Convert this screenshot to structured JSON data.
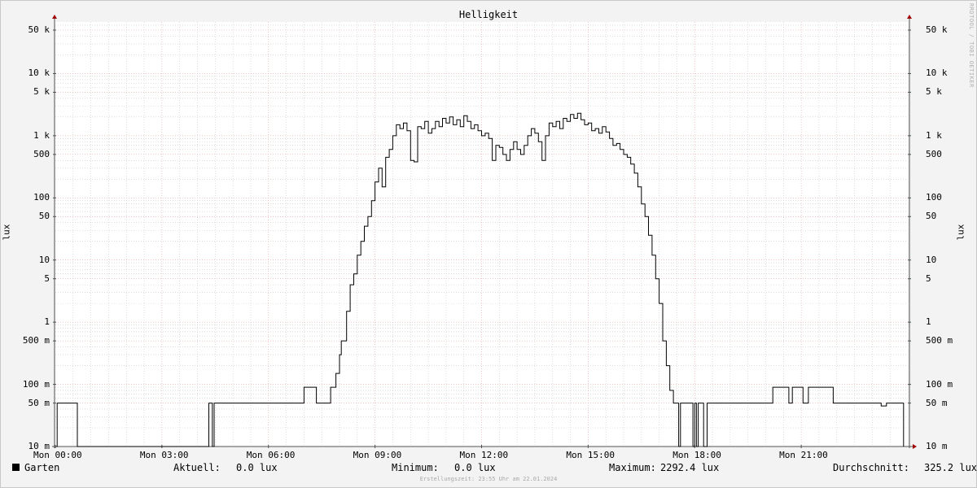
{
  "title": "Helligkeit",
  "ylabel_left": "lux",
  "ylabel_right": "lux",
  "watermark": "RRDTOOL / TOBI OETIKER",
  "legend": {
    "series_name": "Garten",
    "aktuell_label": "Aktuell:",
    "aktuell_value": "0.0 lux",
    "minimum_label": "Minimum:",
    "minimum_value": "0.0 lux",
    "maximum_label": "Maximum:",
    "maximum_value": "2292.4 lux",
    "avg_label": "Durchschnitt:",
    "avg_value": "325.2 lux"
  },
  "created": "Erstellungszeit: 23:55 Uhr am 22.01.2024",
  "colors": {
    "line": "#000000",
    "major_grid": "#e8a0a0",
    "minor_grid": "#c8c8c8",
    "axis": "#505050",
    "arrow": "#a00000",
    "plot_bg": "#ffffff"
  },
  "chart_data": {
    "type": "line",
    "title": "Helligkeit",
    "ylabel": "lux",
    "yscale": "log",
    "ylim": [
      0.01,
      70000
    ],
    "xlim_hours": [
      0,
      24
    ],
    "xticks": [
      {
        "hour": 0,
        "label": "Mon 00:00"
      },
      {
        "hour": 3,
        "label": "Mon 03:00"
      },
      {
        "hour": 6,
        "label": "Mon 06:00"
      },
      {
        "hour": 9,
        "label": "Mon 09:00"
      },
      {
        "hour": 12,
        "label": "Mon 12:00"
      },
      {
        "hour": 15,
        "label": "Mon 15:00"
      },
      {
        "hour": 18,
        "label": "Mon 18:00"
      },
      {
        "hour": 21,
        "label": "Mon 21:00"
      }
    ],
    "yticks": [
      {
        "value": 0.01,
        "label": "10 m"
      },
      {
        "value": 0.05,
        "label": "50 m"
      },
      {
        "value": 0.1,
        "label": "100 m"
      },
      {
        "value": 0.5,
        "label": "500 m"
      },
      {
        "value": 1,
        "label": "1"
      },
      {
        "value": 5,
        "label": "5"
      },
      {
        "value": 10,
        "label": "10"
      },
      {
        "value": 50,
        "label": "50"
      },
      {
        "value": 100,
        "label": "100"
      },
      {
        "value": 500,
        "label": "500"
      },
      {
        "value": 1000,
        "label": "1 k"
      },
      {
        "value": 5000,
        "label": "5 k"
      },
      {
        "value": 10000,
        "label": "10 k"
      },
      {
        "value": 50000,
        "label": "50 k"
      }
    ],
    "grid": true,
    "series": [
      {
        "name": "Garten",
        "points": [
          [
            0.02,
            0.01
          ],
          [
            0.05,
            0.05
          ],
          [
            0.6,
            0.05
          ],
          [
            0.62,
            0.01
          ],
          [
            4.3,
            0.01
          ],
          [
            4.32,
            0.05
          ],
          [
            4.4,
            0.05
          ],
          [
            4.42,
            0.01
          ],
          [
            4.45,
            0.01
          ],
          [
            4.47,
            0.05
          ],
          [
            6.9,
            0.05
          ],
          [
            7.0,
            0.09
          ],
          [
            7.3,
            0.09
          ],
          [
            7.35,
            0.05
          ],
          [
            7.7,
            0.05
          ],
          [
            7.75,
            0.09
          ],
          [
            7.8,
            0.09
          ],
          [
            7.9,
            0.15
          ],
          [
            8.0,
            0.3
          ],
          [
            8.05,
            0.5
          ],
          [
            8.15,
            0.5
          ],
          [
            8.2,
            1.5
          ],
          [
            8.3,
            4
          ],
          [
            8.4,
            6
          ],
          [
            8.5,
            12
          ],
          [
            8.6,
            20
          ],
          [
            8.7,
            35
          ],
          [
            8.8,
            50
          ],
          [
            8.9,
            90
          ],
          [
            9.0,
            180
          ],
          [
            9.1,
            300
          ],
          [
            9.2,
            150
          ],
          [
            9.3,
            450
          ],
          [
            9.4,
            600
          ],
          [
            9.5,
            1000
          ],
          [
            9.6,
            1500
          ],
          [
            9.7,
            1300
          ],
          [
            9.8,
            1600
          ],
          [
            9.9,
            1200
          ],
          [
            10.0,
            400
          ],
          [
            10.1,
            380
          ],
          [
            10.2,
            1400
          ],
          [
            10.3,
            1300
          ],
          [
            10.4,
            1700
          ],
          [
            10.5,
            1100
          ],
          [
            10.6,
            1300
          ],
          [
            10.7,
            1700
          ],
          [
            10.8,
            1400
          ],
          [
            10.9,
            1900
          ],
          [
            11.0,
            1600
          ],
          [
            11.1,
            2000
          ],
          [
            11.2,
            1500
          ],
          [
            11.3,
            1800
          ],
          [
            11.4,
            1400
          ],
          [
            11.5,
            2100
          ],
          [
            11.6,
            1700
          ],
          [
            11.7,
            1300
          ],
          [
            11.8,
            1500
          ],
          [
            11.9,
            1200
          ],
          [
            12.0,
            1000
          ],
          [
            12.1,
            1100
          ],
          [
            12.2,
            900
          ],
          [
            12.3,
            400
          ],
          [
            12.4,
            700
          ],
          [
            12.5,
            650
          ],
          [
            12.6,
            500
          ],
          [
            12.7,
            400
          ],
          [
            12.8,
            600
          ],
          [
            12.9,
            800
          ],
          [
            13.0,
            600
          ],
          [
            13.1,
            500
          ],
          [
            13.2,
            700
          ],
          [
            13.3,
            1000
          ],
          [
            13.4,
            1300
          ],
          [
            13.5,
            1100
          ],
          [
            13.6,
            800
          ],
          [
            13.7,
            400
          ],
          [
            13.8,
            1000
          ],
          [
            13.9,
            1600
          ],
          [
            14.0,
            1400
          ],
          [
            14.1,
            1700
          ],
          [
            14.2,
            1300
          ],
          [
            14.3,
            1900
          ],
          [
            14.4,
            1700
          ],
          [
            14.5,
            2200
          ],
          [
            14.6,
            1900
          ],
          [
            14.7,
            2292
          ],
          [
            14.8,
            1800
          ],
          [
            14.9,
            1500
          ],
          [
            15.0,
            1600
          ],
          [
            15.1,
            1200
          ],
          [
            15.2,
            1300
          ],
          [
            15.3,
            1100
          ],
          [
            15.4,
            1400
          ],
          [
            15.5,
            1150
          ],
          [
            15.6,
            900
          ],
          [
            15.7,
            700
          ],
          [
            15.8,
            750
          ],
          [
            15.9,
            600
          ],
          [
            16.0,
            500
          ],
          [
            16.1,
            450
          ],
          [
            16.2,
            350
          ],
          [
            16.3,
            250
          ],
          [
            16.4,
            150
          ],
          [
            16.5,
            80
          ],
          [
            16.6,
            50
          ],
          [
            16.7,
            25
          ],
          [
            16.8,
            12
          ],
          [
            16.9,
            5
          ],
          [
            17.0,
            2
          ],
          [
            17.1,
            0.5
          ],
          [
            17.2,
            0.2
          ],
          [
            17.3,
            0.08
          ],
          [
            17.4,
            0.05
          ],
          [
            17.5,
            0.05
          ],
          [
            17.55,
            0.01
          ],
          [
            17.6,
            0.05
          ],
          [
            17.9,
            0.05
          ],
          [
            17.95,
            0.01
          ],
          [
            18.0,
            0.05
          ],
          [
            18.05,
            0.01
          ],
          [
            18.1,
            0.05
          ],
          [
            18.2,
            0.05
          ],
          [
            18.25,
            0.01
          ],
          [
            18.3,
            0.01
          ],
          [
            18.35,
            0.05
          ],
          [
            20.1,
            0.05
          ],
          [
            20.2,
            0.09
          ],
          [
            20.6,
            0.09
          ],
          [
            20.65,
            0.05
          ],
          [
            20.7,
            0.05
          ],
          [
            20.75,
            0.09
          ],
          [
            21.0,
            0.09
          ],
          [
            21.05,
            0.05
          ],
          [
            21.15,
            0.05
          ],
          [
            21.2,
            0.09
          ],
          [
            21.85,
            0.09
          ],
          [
            21.9,
            0.05
          ],
          [
            23.2,
            0.05
          ],
          [
            23.25,
            0.045
          ],
          [
            23.4,
            0.05
          ],
          [
            23.85,
            0.05
          ],
          [
            23.88,
            0.01
          ]
        ]
      }
    ]
  }
}
